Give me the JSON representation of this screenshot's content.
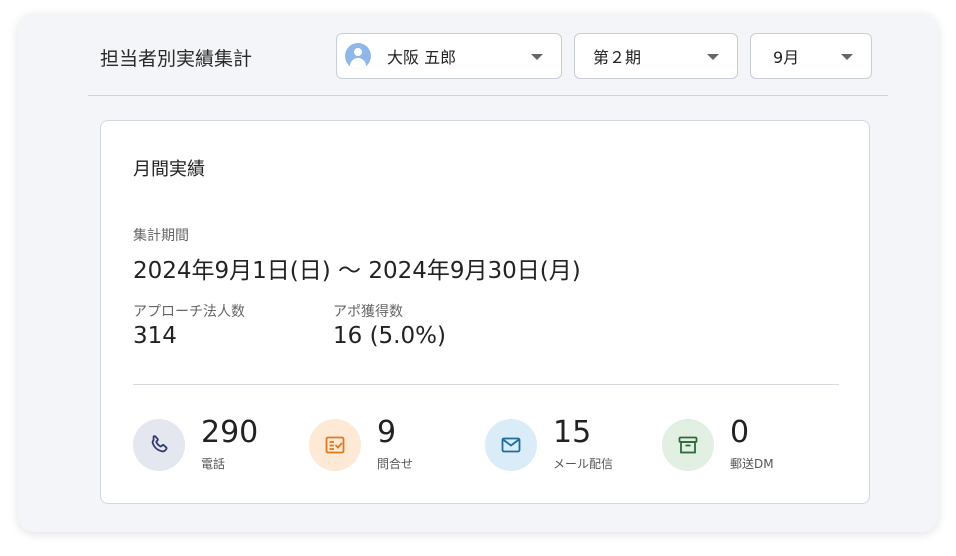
{
  "header": {
    "title": "担当者別実績集計",
    "person_select": {
      "value": "大阪 五郎",
      "icon": "person-icon"
    },
    "period_select": {
      "value": "第２期"
    },
    "month_select": {
      "value": "9月"
    }
  },
  "card": {
    "title": "月間実績",
    "period_label": "集計期間",
    "period_value": "2024年9月1日(日) 〜 2024年9月30日(月)",
    "approach_label": "アプローチ法人数",
    "approach_value": "314",
    "appointment_label": "アポ獲得数",
    "appointment_value": "16 (5.0%)",
    "stats": [
      {
        "icon": "phone-icon",
        "value": "290",
        "label": "電話",
        "color": "#2d3a6b",
        "bg": "#e4e6f0"
      },
      {
        "icon": "form-check-icon",
        "value": "9",
        "label": "問合せ",
        "color": "#e07a1c",
        "bg": "#fde9d6"
      },
      {
        "icon": "mail-icon",
        "value": "15",
        "label": "メール配信",
        "color": "#1e6e9e",
        "bg": "#d9ecf7"
      },
      {
        "icon": "archive-icon",
        "value": "0",
        "label": "郵送DM",
        "color": "#2e6b3a",
        "bg": "#e2efe3"
      }
    ]
  }
}
